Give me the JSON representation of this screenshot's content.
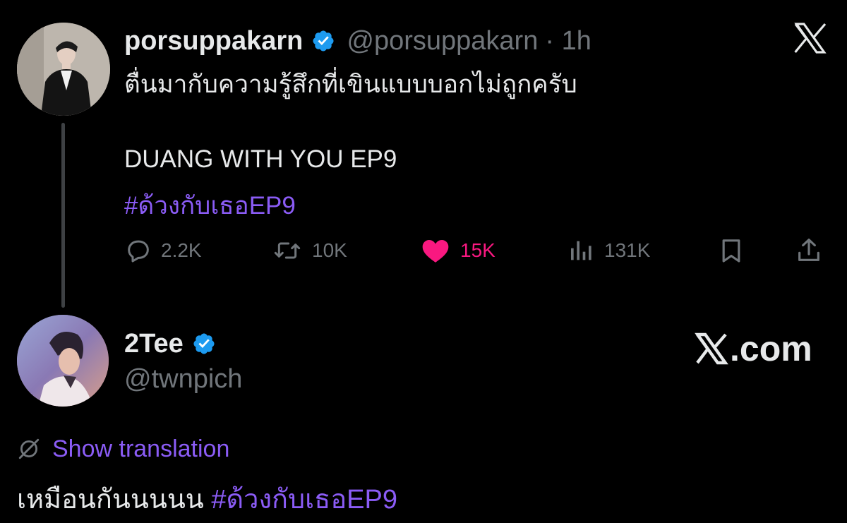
{
  "tweet": {
    "author": {
      "display_name": "porsuppakarn",
      "handle": "@porsuppakarn",
      "time": "· 1h",
      "verified": true
    },
    "text_line1": "ตื่นมากับความรู้สึกที่เขินแบบบอกไม่ถูกครับ",
    "text_line2": "DUANG WITH YOU EP9",
    "hashtag": "#ด้วงกับเธอEP9",
    "actions": {
      "replies": "2.2K",
      "reposts": "10K",
      "likes": "15K",
      "views": "131K"
    },
    "icons": {
      "reply": "reply-icon",
      "repost": "repost-icon",
      "like": "heart-icon",
      "views": "views-icon",
      "bookmark": "bookmark-icon",
      "share": "share-icon",
      "platform": "x-logo-icon"
    }
  },
  "reply": {
    "author": {
      "display_name": "2Tee",
      "handle": "@twnpich",
      "verified": true
    },
    "watermark": ".com",
    "show_translation": "Show translation",
    "text": "เหมือนกันนนนน",
    "hashtag": "#ด้วงกับเธอEP9"
  },
  "colors": {
    "background": "#000000",
    "text_primary": "#e7e9ea",
    "text_secondary": "#71767b",
    "link": "#8b5cf6",
    "like": "#f91880",
    "verified": "#1d9bf0"
  }
}
